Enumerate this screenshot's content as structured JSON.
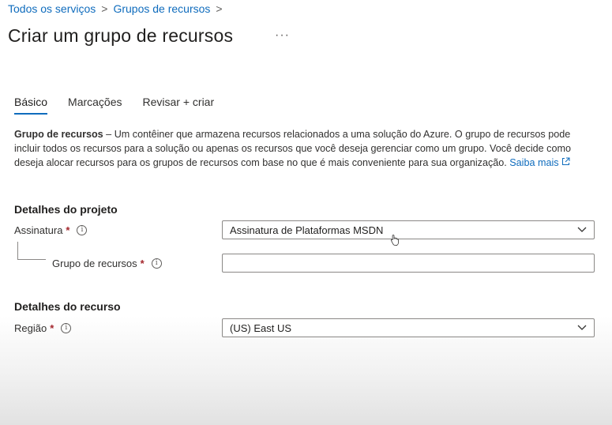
{
  "breadcrumb": {
    "items": [
      "Todos os serviços",
      "Grupos de recursos"
    ],
    "separator": ">"
  },
  "page": {
    "title": "Criar um grupo de recursos",
    "more": "···"
  },
  "tabs": [
    {
      "label": "Básico",
      "active": true
    },
    {
      "label": "Marcações",
      "active": false
    },
    {
      "label": "Revisar + criar",
      "active": false
    }
  ],
  "description": {
    "bold": "Grupo de recursos",
    "text": " – Um contêiner que armazena recursos relacionados a uma solução do Azure. O grupo de recursos pode incluir todos os recursos para a solução ou apenas os recursos que você deseja gerenciar como um grupo. Você decide como deseja alocar recursos para os grupos de recursos com base no que é mais conveniente para sua organização. ",
    "link": "Saiba mais"
  },
  "project_details": {
    "title": "Detalhes do projeto",
    "subscription": {
      "label": "Assinatura",
      "required": "*",
      "value": "Assinatura de Plataformas MSDN"
    },
    "resource_group": {
      "label": "Grupo de recursos",
      "required": "*",
      "value": ""
    }
  },
  "resource_details": {
    "title": "Detalhes do recurso",
    "region": {
      "label": "Região",
      "required": "*",
      "value": "(US) East US"
    }
  },
  "colors": {
    "accent": "#0f6cbd",
    "required": "#a4262c",
    "text": "#323130"
  }
}
